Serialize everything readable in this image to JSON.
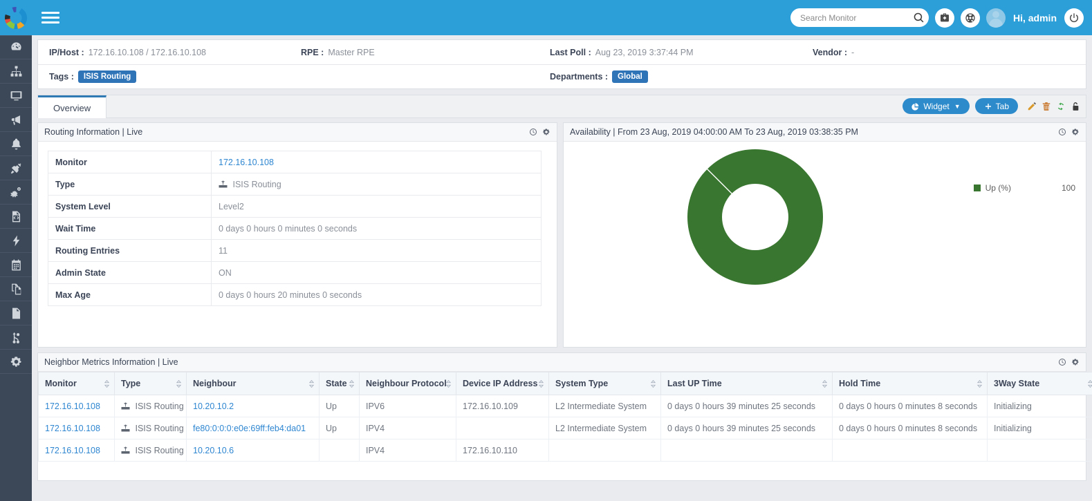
{
  "app": {
    "logo_name": "donut-logo",
    "brand_color": "#2c9fd9"
  },
  "topbar": {
    "menu_label": "menu-toggle",
    "search": {
      "value": "",
      "placeholder": "Search Monitor"
    },
    "icons": [
      "search-icon",
      "toolkit-icon",
      "support-icon"
    ],
    "greeting": "Hi, admin",
    "logout_label": "power-icon"
  },
  "sidebar": {
    "items": [
      {
        "name": "dashboard",
        "icon": "gauge-icon"
      },
      {
        "name": "topology",
        "icon": "sitemap-icon"
      },
      {
        "name": "monitors",
        "icon": "desktop-icon"
      },
      {
        "name": "announcements",
        "icon": "megaphone-icon"
      },
      {
        "name": "alerts",
        "icon": "bell-icon"
      },
      {
        "name": "plugins",
        "icon": "plug-icon"
      },
      {
        "name": "automation",
        "icon": "gears-icon"
      },
      {
        "name": "scripts",
        "icon": "code-file-icon"
      },
      {
        "name": "performance",
        "icon": "bolt-icon"
      },
      {
        "name": "schedule",
        "icon": "calendar-icon"
      },
      {
        "name": "inventory",
        "icon": "copy-icon"
      },
      {
        "name": "reports",
        "icon": "document-icon"
      },
      {
        "name": "workflow",
        "icon": "branch-icon"
      },
      {
        "name": "settings",
        "icon": "gear-icon"
      }
    ]
  },
  "info": {
    "ip_host_label": "IP/Host :",
    "ip_host_value": "172.16.10.108 / 172.16.10.108",
    "rpe_label": "RPE :",
    "rpe_value": "Master RPE",
    "last_poll_label": "Last Poll :",
    "last_poll_value": "Aug 23, 2019 3:37:44 PM",
    "vendor_label": "Vendor :",
    "vendor_value": "-",
    "tags_label": "Tags :",
    "tags_value": "ISIS Routing",
    "departments_label": "Departments :",
    "departments_value": "Global"
  },
  "tabbar": {
    "tabs": [
      {
        "label": "Overview",
        "active": true
      }
    ],
    "widget_button": "Widget",
    "tab_button": "Tab",
    "tools": [
      "edit-icon",
      "delete-icon",
      "refresh-icon",
      "unlock-icon"
    ]
  },
  "routing_panel": {
    "title": "Routing Information | Live",
    "head_icons": [
      "clock-icon",
      "gear-icon"
    ],
    "rows": [
      {
        "key": "Monitor",
        "value": "172.16.10.108",
        "link": true
      },
      {
        "key": "Type",
        "value": "ISIS Routing",
        "icon": "router-icon"
      },
      {
        "key": "System Level",
        "value": "Level2"
      },
      {
        "key": "Wait Time",
        "value": "0 days 0 hours 0 minutes 0 seconds"
      },
      {
        "key": "Routing Entries",
        "value": "11"
      },
      {
        "key": "Admin State",
        "value": "ON"
      },
      {
        "key": "Max Age",
        "value": "0 days 0 hours 20 minutes 0 seconds"
      }
    ]
  },
  "availability_panel": {
    "title": "Availability | From 23 Aug, 2019 04:00:00 AM To 23 Aug, 2019 03:38:35 PM",
    "head_icons": [
      "clock-icon",
      "gear-icon"
    ],
    "legend_label": "Up (%)",
    "legend_value": "100"
  },
  "chart_data": {
    "type": "pie",
    "title": "Availability | From 23 Aug, 2019 04:00:00 AM To 23 Aug, 2019 03:38:35 PM",
    "donut": true,
    "labels": [
      "Up (%)"
    ],
    "values": [
      100
    ],
    "colors": [
      "#39762f"
    ],
    "legend_position": "right",
    "data_labels": {
      "Up (%)": "100"
    }
  },
  "neighbor_panel": {
    "title": "Neighbor Metrics Information | Live",
    "head_icons": [
      "clock-icon",
      "gear-icon"
    ],
    "columns": [
      "Monitor",
      "Type",
      "Neighbour",
      "State",
      "Neighbour Protocol",
      "Device IP Address",
      "System Type",
      "Last UP Time",
      "Hold Time",
      "3Way State"
    ],
    "rows": [
      {
        "monitor": "172.16.10.108",
        "type": "ISIS Routing",
        "neighbour": "10.20.10.2",
        "state": "Up",
        "protocol": "IPV6",
        "device_ip": "172.16.10.109",
        "system_type": "L2 Intermediate System",
        "last_up_time": "0 days 0 hours 39 minutes 25 seconds",
        "hold_time": "0 days 0 hours 0 minutes 8 seconds",
        "three_way_state": "Initializing"
      },
      {
        "monitor": "172.16.10.108",
        "type": "ISIS Routing",
        "neighbour": "fe80:0:0:0:e0e:69ff:feb4:da01",
        "state": "Up",
        "protocol": "IPV4",
        "device_ip": "",
        "system_type": "L2 Intermediate System",
        "last_up_time": "0 days 0 hours 39 minutes 25 seconds",
        "hold_time": "0 days 0 hours 0 minutes 8 seconds",
        "three_way_state": "Initializing"
      },
      {
        "monitor": "172.16.10.108",
        "type": "ISIS Routing",
        "neighbour": "10.20.10.6",
        "state": "",
        "protocol": "IPV4",
        "device_ip": "172.16.10.110",
        "system_type": "",
        "last_up_time": "",
        "hold_time": "",
        "three_way_state": ""
      }
    ]
  }
}
